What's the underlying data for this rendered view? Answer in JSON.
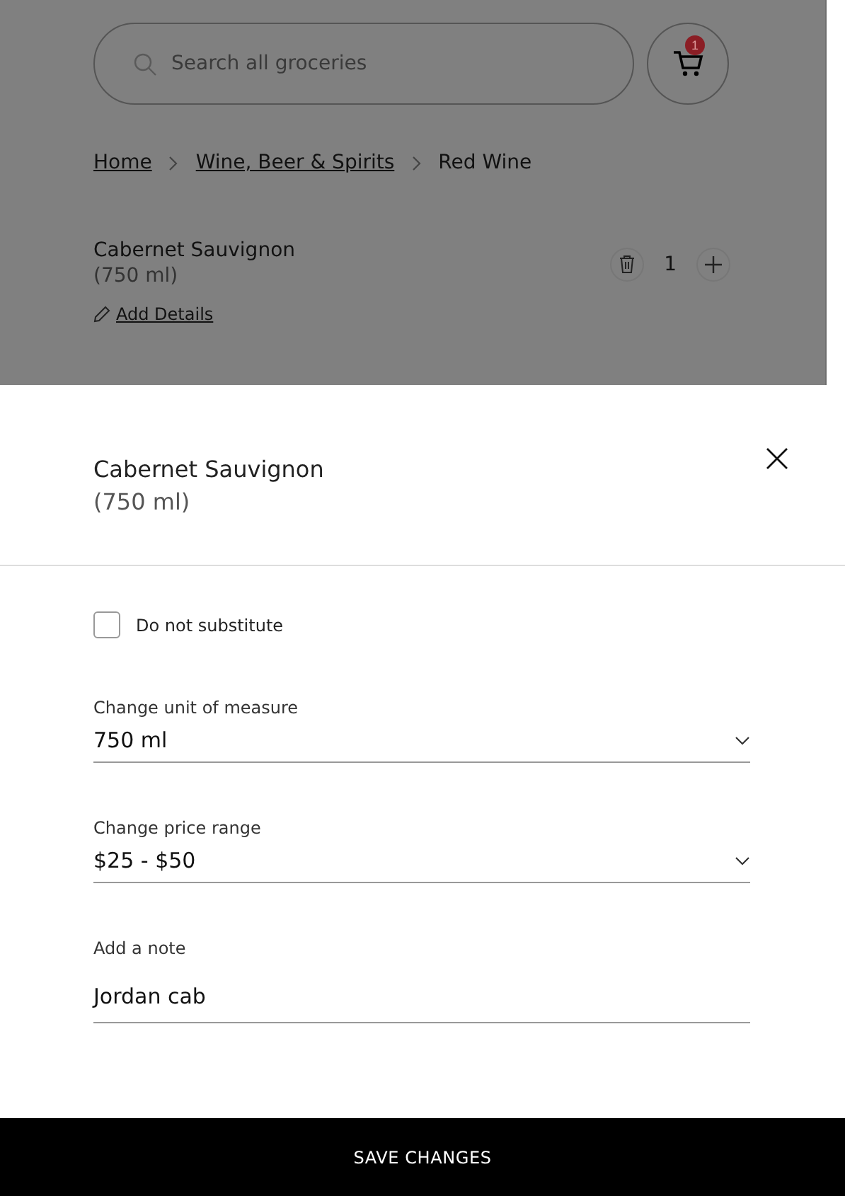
{
  "search": {
    "placeholder": "Search all groceries"
  },
  "cart": {
    "count": "1"
  },
  "breadcrumbs": [
    {
      "label": "Home",
      "kind": "link"
    },
    {
      "label": "Wine, Beer & Spirits",
      "kind": "link"
    },
    {
      "label": "Red Wine",
      "kind": "current"
    }
  ],
  "cart_item": {
    "name": "Cabernet Sauvignon",
    "size": "(750 ml)",
    "quantity": "1",
    "details_link": "Add Details"
  },
  "sheet": {
    "title": "Cabernet Sauvignon",
    "subtitle": "(750 ml)",
    "substitute": {
      "label": "Do not substitute",
      "checked": false
    },
    "fields": [
      {
        "kind": "select",
        "label": "Change unit of measure",
        "value": "750 ml"
      },
      {
        "kind": "select",
        "label": "Change price range",
        "value": "$25 - $50"
      },
      {
        "kind": "text",
        "label": "Add a note",
        "value": "Jordan cab"
      }
    ],
    "save_button": "SAVE CHANGES"
  }
}
